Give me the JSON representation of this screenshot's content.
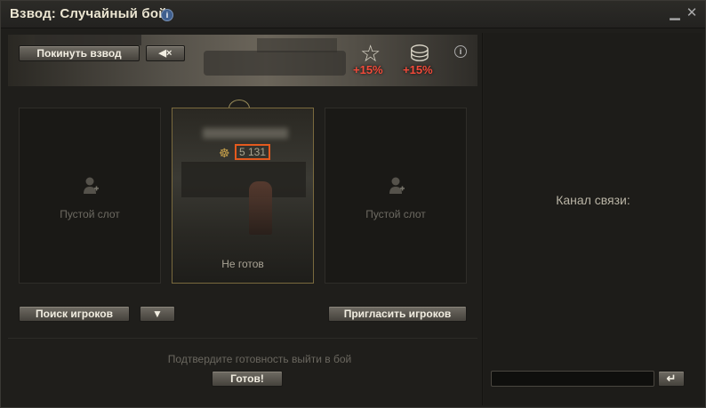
{
  "window": {
    "title": "Взвод: Случайный бой",
    "info_glyph": "i",
    "minimize_glyph": "▁",
    "close_glyph": "✕"
  },
  "banner": {
    "leave_button": "Покинуть взвод",
    "mute_button": "◀×",
    "bonuses": [
      {
        "icon": "star-icon",
        "glyph": "☆",
        "value": "+15%"
      },
      {
        "icon": "credits-icon",
        "glyph": "⛁",
        "value": "+15%"
      }
    ],
    "info_glyph": "i"
  },
  "slots": [
    {
      "label": "Пустой слот",
      "state": "empty"
    },
    {
      "label": "Не готов",
      "state": "occupied",
      "rating": "5 131",
      "rating_icon": "☸"
    },
    {
      "label": "Пустой слот",
      "state": "empty"
    }
  ],
  "actions": {
    "search_players": "Поиск игроков",
    "filter": "▼",
    "invite_players": "Пригласить игроков",
    "confirm_text": "Подтвердите готовность выйти в бой",
    "ready": "Готов!"
  },
  "chat": {
    "channel_label": "Канал связи:",
    "input_value": "",
    "send_glyph": "↵"
  },
  "colors": {
    "accent_orange": "#e35a1e",
    "bonus_red": "#f24a3a"
  }
}
